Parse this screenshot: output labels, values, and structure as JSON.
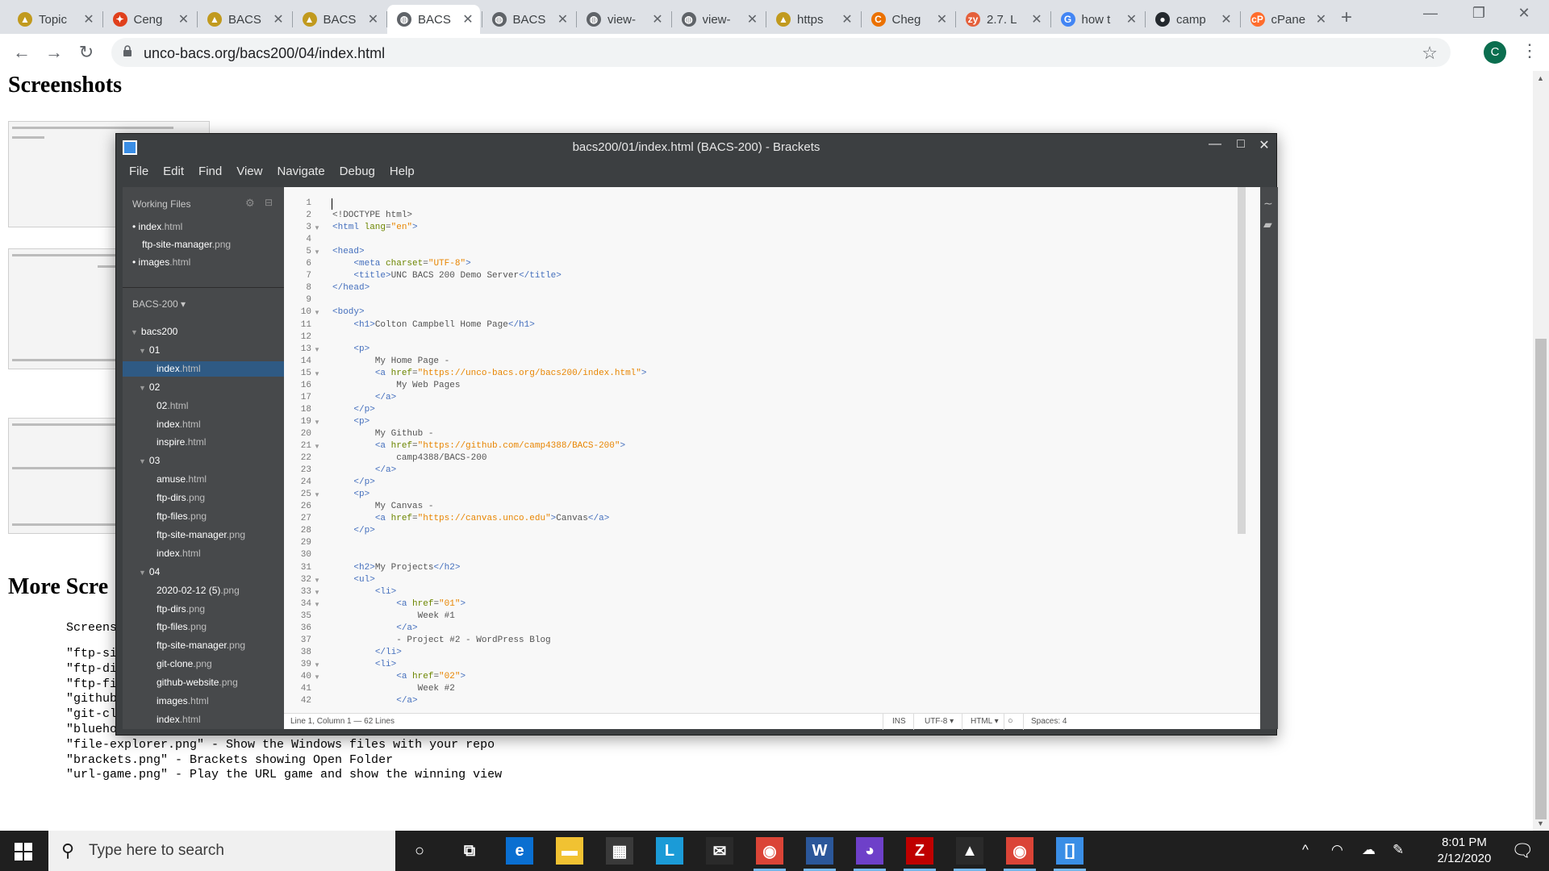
{
  "browser": {
    "tabs": [
      {
        "title": "Topic",
        "icon": "unc-bear-icon",
        "color": "#c19a1e"
      },
      {
        "title": "Ceng",
        "icon": "cengage-icon",
        "color": "#e0401c"
      },
      {
        "title": "BACS",
        "icon": "unc-bear-icon",
        "color": "#c19a1e"
      },
      {
        "title": "BACS",
        "icon": "unc-bear-icon",
        "color": "#c19a1e"
      },
      {
        "title": "BACS",
        "icon": "globe-icon",
        "color": "#5f6368"
      },
      {
        "title": "BACS",
        "icon": "globe-icon",
        "color": "#5f6368"
      },
      {
        "title": "view-",
        "icon": "globe-icon",
        "color": "#5f6368"
      },
      {
        "title": "view-",
        "icon": "globe-icon",
        "color": "#5f6368"
      },
      {
        "title": "https",
        "icon": "unc-bear-icon",
        "color": "#c19a1e"
      },
      {
        "title": "Cheg",
        "icon": "chegg-icon",
        "color": "#eb7100"
      },
      {
        "title": "2.7. L",
        "icon": "zybooks-icon",
        "color": "#e5603b"
      },
      {
        "title": "how t",
        "icon": "google-icon",
        "color": "#4285f4"
      },
      {
        "title": "camp",
        "icon": "github-icon",
        "color": "#24292e"
      },
      {
        "title": "cPane",
        "icon": "cpanel-icon",
        "color": "#ff6c2c"
      }
    ],
    "active_tab": 4,
    "url": "unco-bacs.org/bacs200/04/index.html",
    "profile_initial": "C"
  },
  "page": {
    "heading_screenshots": "Screenshots",
    "heading_more": "More Scre",
    "mono_lines": [
      "Screens",
      "\"ftp-si",
      "\"ftp-di",
      "\"ftp-fi",
      "\"github",
      "\"git-cl",
      "\"bluehost.png\" - Show the Advanced tab of the Bluehost control panel",
      "\"file-explorer.png\" - Show the Windows files with your repo",
      "\"brackets.png\" - Brackets showing Open Folder",
      "\"url-game.png\" - Play the URL game and show the winning view"
    ]
  },
  "brackets": {
    "title": "bacs200/01/index.html (BACS-200) - Brackets",
    "menu": [
      "File",
      "Edit",
      "Find",
      "View",
      "Navigate",
      "Debug",
      "Help"
    ],
    "working_files_label": "Working Files",
    "working_files": [
      {
        "name": "index",
        "ext": ".html",
        "dot": true
      },
      {
        "name": "ftp-site-manager",
        "ext": ".png",
        "dot": false
      },
      {
        "name": "images",
        "ext": ".html",
        "dot": true
      }
    ],
    "project_label": "BACS-200 ▾",
    "tree": [
      {
        "name": "bacs200",
        "ext": "",
        "level": 0,
        "folder": true
      },
      {
        "name": "01",
        "ext": "",
        "level": 1,
        "folder": true
      },
      {
        "name": "index",
        "ext": ".html",
        "level": 2,
        "selected": true
      },
      {
        "name": "02",
        "ext": "",
        "level": 1,
        "folder": true
      },
      {
        "name": "02",
        "ext": ".html",
        "level": 2
      },
      {
        "name": "index",
        "ext": ".html",
        "level": 2
      },
      {
        "name": "inspire",
        "ext": ".html",
        "level": 2
      },
      {
        "name": "03",
        "ext": "",
        "level": 1,
        "folder": true
      },
      {
        "name": "amuse",
        "ext": ".html",
        "level": 2
      },
      {
        "name": "ftp-dirs",
        "ext": ".png",
        "level": 2
      },
      {
        "name": "ftp-files",
        "ext": ".png",
        "level": 2
      },
      {
        "name": "ftp-site-manager",
        "ext": ".png",
        "level": 2
      },
      {
        "name": "index",
        "ext": ".html",
        "level": 2
      },
      {
        "name": "04",
        "ext": "",
        "level": 1,
        "folder": true
      },
      {
        "name": "2020-02-12 (5)",
        "ext": ".png",
        "level": 2
      },
      {
        "name": "ftp-dirs",
        "ext": ".png",
        "level": 2
      },
      {
        "name": "ftp-files",
        "ext": ".png",
        "level": 2
      },
      {
        "name": "ftp-site-manager",
        "ext": ".png",
        "level": 2
      },
      {
        "name": "git-clone",
        "ext": ".png",
        "level": 2
      },
      {
        "name": "github-website",
        "ext": ".png",
        "level": 2
      },
      {
        "name": "images",
        "ext": ".html",
        "level": 2
      },
      {
        "name": "index",
        "ext": ".html",
        "level": 2
      }
    ],
    "code_lines": [
      {
        "n": "1",
        "fold": false,
        "t": [
          [
            "",
            ""
          ]
        ]
      },
      {
        "n": "2",
        "fold": false,
        "t": [
          [
            "<!DOCTYPE html>",
            ""
          ]
        ]
      },
      {
        "n": "3",
        "fold": true,
        "t": [
          [
            "<html ",
            "tag"
          ],
          [
            "lang",
            "attr"
          ],
          [
            "=",
            ""
          ],
          [
            "\"en\"",
            "str"
          ],
          [
            ">",
            "tag"
          ]
        ]
      },
      {
        "n": "4",
        "fold": false,
        "t": [
          [
            "",
            ""
          ]
        ]
      },
      {
        "n": "5",
        "fold": true,
        "t": [
          [
            "<head>",
            "tag"
          ]
        ]
      },
      {
        "n": "6",
        "fold": false,
        "t": [
          [
            "    ",
            ""
          ],
          [
            "<meta ",
            "tag"
          ],
          [
            "charset",
            "attr"
          ],
          [
            "=",
            ""
          ],
          [
            "\"UTF-8\"",
            "str"
          ],
          [
            ">",
            "tag"
          ]
        ]
      },
      {
        "n": "7",
        "fold": false,
        "t": [
          [
            "    ",
            ""
          ],
          [
            "<title>",
            "tag"
          ],
          [
            "UNC BACS 200 Demo Server",
            ""
          ],
          [
            "</title>",
            "tag"
          ]
        ]
      },
      {
        "n": "8",
        "fold": false,
        "t": [
          [
            "</head>",
            "tag"
          ]
        ]
      },
      {
        "n": "9",
        "fold": false,
        "t": [
          [
            "",
            ""
          ]
        ]
      },
      {
        "n": "10",
        "fold": true,
        "t": [
          [
            "<body>",
            "tag"
          ]
        ]
      },
      {
        "n": "11",
        "fold": false,
        "t": [
          [
            "    ",
            ""
          ],
          [
            "<h1>",
            "tag"
          ],
          [
            "Colton Campbell Home Page",
            ""
          ],
          [
            "</h1>",
            "tag"
          ]
        ]
      },
      {
        "n": "12",
        "fold": false,
        "t": [
          [
            "",
            ""
          ]
        ]
      },
      {
        "n": "13",
        "fold": true,
        "t": [
          [
            "    ",
            ""
          ],
          [
            "<p>",
            "tag"
          ]
        ]
      },
      {
        "n": "14",
        "fold": false,
        "t": [
          [
            "        My Home Page -",
            ""
          ]
        ]
      },
      {
        "n": "15",
        "fold": true,
        "t": [
          [
            "        ",
            ""
          ],
          [
            "<a ",
            "tag"
          ],
          [
            "href",
            "attr"
          ],
          [
            "=",
            ""
          ],
          [
            "\"https://unco-bacs.org/bacs200/index.html\"",
            "str"
          ],
          [
            ">",
            "tag"
          ]
        ]
      },
      {
        "n": "16",
        "fold": false,
        "t": [
          [
            "            My Web Pages",
            ""
          ]
        ]
      },
      {
        "n": "17",
        "fold": false,
        "t": [
          [
            "        ",
            ""
          ],
          [
            "</a>",
            "tag"
          ]
        ]
      },
      {
        "n": "18",
        "fold": false,
        "t": [
          [
            "    ",
            ""
          ],
          [
            "</p>",
            "tag"
          ]
        ]
      },
      {
        "n": "19",
        "fold": true,
        "t": [
          [
            "    ",
            ""
          ],
          [
            "<p>",
            "tag"
          ]
        ]
      },
      {
        "n": "20",
        "fold": false,
        "t": [
          [
            "        My Github -",
            ""
          ]
        ]
      },
      {
        "n": "21",
        "fold": true,
        "t": [
          [
            "        ",
            ""
          ],
          [
            "<a ",
            "tag"
          ],
          [
            "href",
            "attr"
          ],
          [
            "=",
            ""
          ],
          [
            "\"https://github.com/camp4388/BACS-200\"",
            "str"
          ],
          [
            ">",
            "tag"
          ]
        ]
      },
      {
        "n": "22",
        "fold": false,
        "t": [
          [
            "            camp4388/BACS-200",
            ""
          ]
        ]
      },
      {
        "n": "23",
        "fold": false,
        "t": [
          [
            "        ",
            ""
          ],
          [
            "</a>",
            "tag"
          ]
        ]
      },
      {
        "n": "24",
        "fold": false,
        "t": [
          [
            "    ",
            ""
          ],
          [
            "</p>",
            "tag"
          ]
        ]
      },
      {
        "n": "25",
        "fold": true,
        "t": [
          [
            "    ",
            ""
          ],
          [
            "<p>",
            "tag"
          ]
        ]
      },
      {
        "n": "26",
        "fold": false,
        "t": [
          [
            "        My Canvas -",
            ""
          ]
        ]
      },
      {
        "n": "27",
        "fold": false,
        "t": [
          [
            "        ",
            ""
          ],
          [
            "<a ",
            "tag"
          ],
          [
            "href",
            "attr"
          ],
          [
            "=",
            ""
          ],
          [
            "\"https://canvas.unco.edu\"",
            "str"
          ],
          [
            ">",
            "tag"
          ],
          [
            "Canvas",
            ""
          ],
          [
            "</a>",
            "tag"
          ]
        ]
      },
      {
        "n": "28",
        "fold": false,
        "t": [
          [
            "    ",
            ""
          ],
          [
            "</p>",
            "tag"
          ]
        ]
      },
      {
        "n": "29",
        "fold": false,
        "t": [
          [
            "",
            ""
          ]
        ]
      },
      {
        "n": "30",
        "fold": false,
        "t": [
          [
            "",
            ""
          ]
        ]
      },
      {
        "n": "31",
        "fold": false,
        "t": [
          [
            "    ",
            ""
          ],
          [
            "<h2>",
            "tag"
          ],
          [
            "My Projects",
            ""
          ],
          [
            "</h2>",
            "tag"
          ]
        ]
      },
      {
        "n": "32",
        "fold": true,
        "t": [
          [
            "    ",
            ""
          ],
          [
            "<ul>",
            "tag"
          ]
        ]
      },
      {
        "n": "33",
        "fold": true,
        "t": [
          [
            "        ",
            ""
          ],
          [
            "<li>",
            "tag"
          ]
        ]
      },
      {
        "n": "34",
        "fold": true,
        "t": [
          [
            "            ",
            ""
          ],
          [
            "<a ",
            "tag"
          ],
          [
            "href",
            "attr"
          ],
          [
            "=",
            ""
          ],
          [
            "\"01\"",
            "str"
          ],
          [
            ">",
            "tag"
          ]
        ]
      },
      {
        "n": "35",
        "fold": false,
        "t": [
          [
            "                Week #1",
            ""
          ]
        ]
      },
      {
        "n": "36",
        "fold": false,
        "t": [
          [
            "            ",
            ""
          ],
          [
            "</a>",
            "tag"
          ]
        ]
      },
      {
        "n": "37",
        "fold": false,
        "t": [
          [
            "            - Project #2 - WordPress Blog",
            ""
          ]
        ]
      },
      {
        "n": "38",
        "fold": false,
        "t": [
          [
            "        ",
            ""
          ],
          [
            "</li>",
            "tag"
          ]
        ]
      },
      {
        "n": "39",
        "fold": true,
        "t": [
          [
            "        ",
            ""
          ],
          [
            "<li>",
            "tag"
          ]
        ]
      },
      {
        "n": "40",
        "fold": true,
        "t": [
          [
            "            ",
            ""
          ],
          [
            "<a ",
            "tag"
          ],
          [
            "href",
            "attr"
          ],
          [
            "=",
            ""
          ],
          [
            "\"02\"",
            "str"
          ],
          [
            ">",
            "tag"
          ]
        ]
      },
      {
        "n": "41",
        "fold": false,
        "t": [
          [
            "                Week #2",
            ""
          ]
        ]
      },
      {
        "n": "42",
        "fold": false,
        "t": [
          [
            "            ",
            ""
          ],
          [
            "</a>",
            "tag"
          ]
        ]
      }
    ],
    "status": {
      "position": "Line 1, Column 1 — 62 Lines",
      "mode": "INS",
      "encoding": "UTF-8 ▾",
      "language": "HTML ▾",
      "spaces": "Spaces: 4"
    }
  },
  "taskbar": {
    "search_placeholder": "Type here to search",
    "apps": [
      {
        "name": "cortana-icon",
        "glyph": "○",
        "color": "#1f1f1f"
      },
      {
        "name": "task-view-icon",
        "glyph": "⧉",
        "color": "#1f1f1f"
      },
      {
        "name": "edge-icon",
        "glyph": "e",
        "color": "#0a6fd1"
      },
      {
        "name": "file-explorer-icon",
        "glyph": "▬",
        "color": "#f1c232"
      },
      {
        "name": "store-icon",
        "glyph": "▦",
        "color": "#3a3a3a"
      },
      {
        "name": "lockdown-browser-icon",
        "glyph": "L",
        "color": "#1b9bd7"
      },
      {
        "name": "mail-icon",
        "glyph": "✉",
        "color": "#2a2a2a"
      },
      {
        "name": "chrome-icon",
        "glyph": "◉",
        "color": "#db4437"
      },
      {
        "name": "word-icon",
        "glyph": "W",
        "color": "#2b579a"
      },
      {
        "name": "github-desktop-icon",
        "glyph": "◕",
        "color": "#6e40c9"
      },
      {
        "name": "filezilla-icon",
        "glyph": "Z",
        "color": "#bf0000"
      },
      {
        "name": "photos-icon",
        "glyph": "▲",
        "color": "#2a2a2a"
      },
      {
        "name": "chrome-icon-2",
        "glyph": "◉",
        "color": "#db4437"
      },
      {
        "name": "brackets-icon",
        "glyph": "[]",
        "color": "#3a8ee6"
      }
    ],
    "time": "8:01 PM",
    "date": "2/12/2020",
    "notification_count": "1"
  }
}
